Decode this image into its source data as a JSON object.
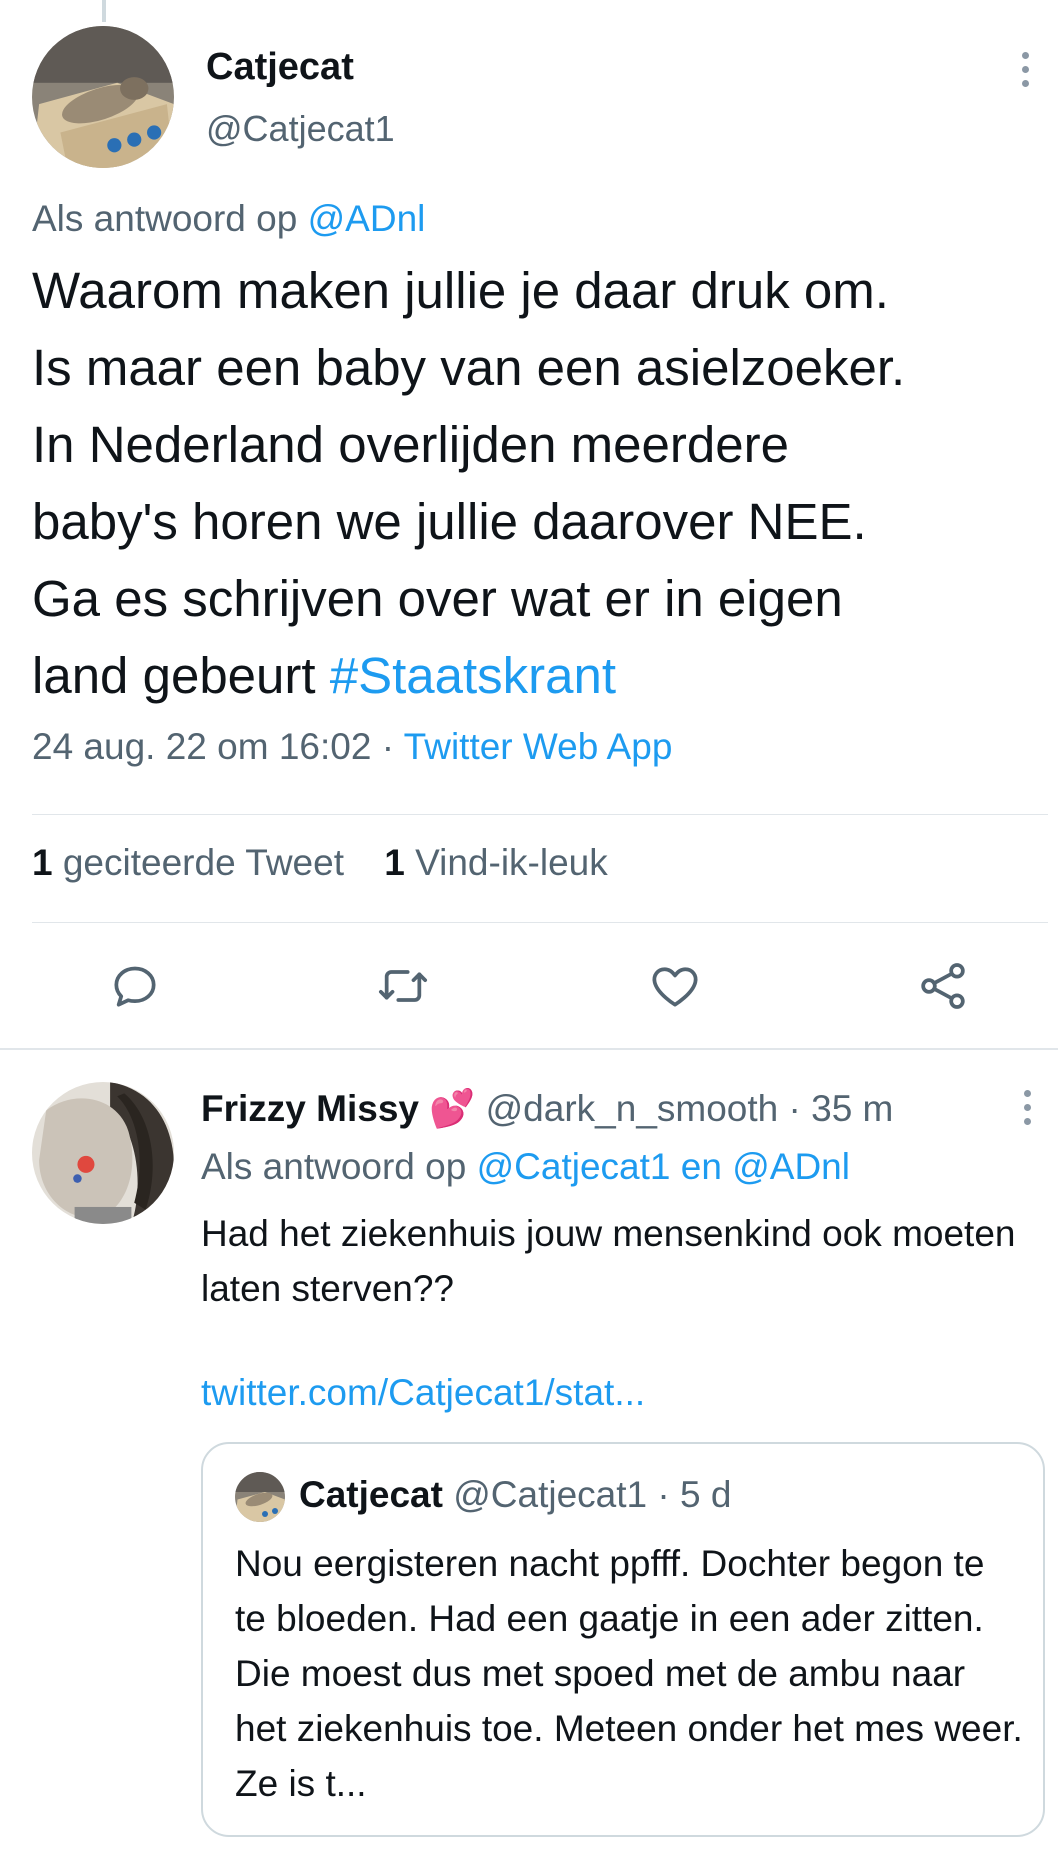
{
  "colors": {
    "link": "#1d9bf0",
    "muted": "#536471",
    "text": "#0f1419",
    "divider": "#e1e6ea"
  },
  "main_tweet": {
    "name": "Catjecat",
    "handle": "@Catjecat1",
    "reply_prefix": "Als antwoord op",
    "reply_to": "@ADnl",
    "text": "Waarom maken jullie je daar druk om.\nIs maar een baby van een asielzoeker.\nIn Nederland overlijden meerdere\nbaby's horen we jullie daarover NEE.\nGa es schrijven over wat er in eigen\nland gebeurt ",
    "hashtag": "#Staatskrant",
    "timestamp": "24 aug. 22 om 16:02",
    "separator": "·",
    "source": "Twitter Web App",
    "stats": {
      "quote_count": "1",
      "quote_label": "geciteerde Tweet",
      "like_count": "1",
      "like_label": "Vind-ik-leuk"
    },
    "actions": [
      "reply-icon",
      "retweet-icon",
      "like-icon",
      "share-icon"
    ],
    "more_icon": "more-vertical-icon"
  },
  "reply_tweet": {
    "name": "Frizzy Missy",
    "emoji": "💕",
    "handle": "@dark_n_smooth",
    "time": "· 35 m",
    "reply_prefix": "Als antwoord op",
    "reply_to_1": "@Catjecat1",
    "reply_conj": "en",
    "reply_to_2": "@ADnl",
    "text": "Had het ziekenhuis jouw mensenkind ook moeten laten sterven??",
    "link": "twitter.com/Catjecat1/stat...",
    "more_icon": "more-vertical-icon"
  },
  "quoted_tweet": {
    "name": "Catjecat",
    "handle": "@Catjecat1",
    "time": "· 5 d",
    "text": "Nou eergisteren nacht ppfff. Dochter begon te te bloeden. Had een gaatje in een ader zitten. Die moest dus met spoed met de ambu naar het ziekenhuis toe. Meteen onder het mes weer. Ze is t..."
  }
}
